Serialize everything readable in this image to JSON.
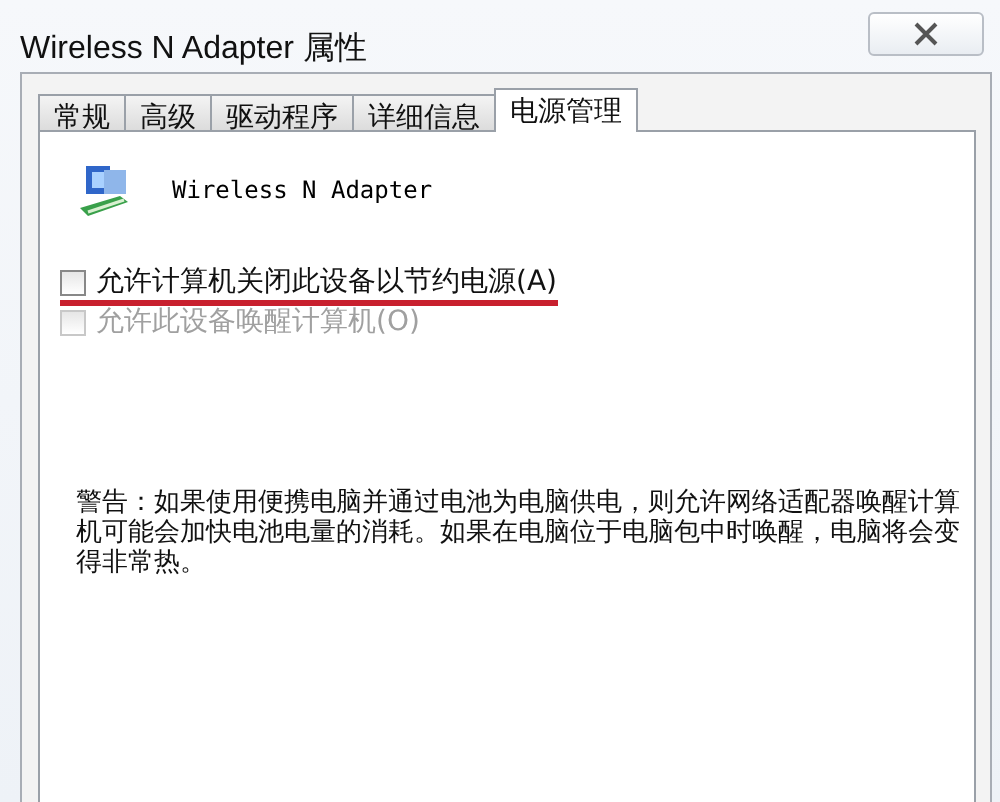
{
  "window": {
    "title": "Wireless N Adapter 属性"
  },
  "tabs": [
    {
      "label": "常规",
      "selected": false
    },
    {
      "label": "高级",
      "selected": false
    },
    {
      "label": "驱动程序",
      "selected": false
    },
    {
      "label": "详细信息",
      "selected": false
    },
    {
      "label": "电源管理",
      "selected": true
    }
  ],
  "device": {
    "name": "Wireless N Adapter"
  },
  "options": [
    {
      "label": "允许计算机关闭此设备以节约电源(A)",
      "checked": false,
      "disabled": false,
      "highlighted": true
    },
    {
      "label": "允许此设备唤醒计算机(O)",
      "checked": false,
      "disabled": true,
      "highlighted": false
    }
  ],
  "warning": "警告：如果使用便携电脑并通过电池为电脑供电，则允许网络适配器唤醒计算机可能会加快电池电量的消耗。如果在电脑位于电脑包中时唤醒，电脑将会变得非常热。"
}
